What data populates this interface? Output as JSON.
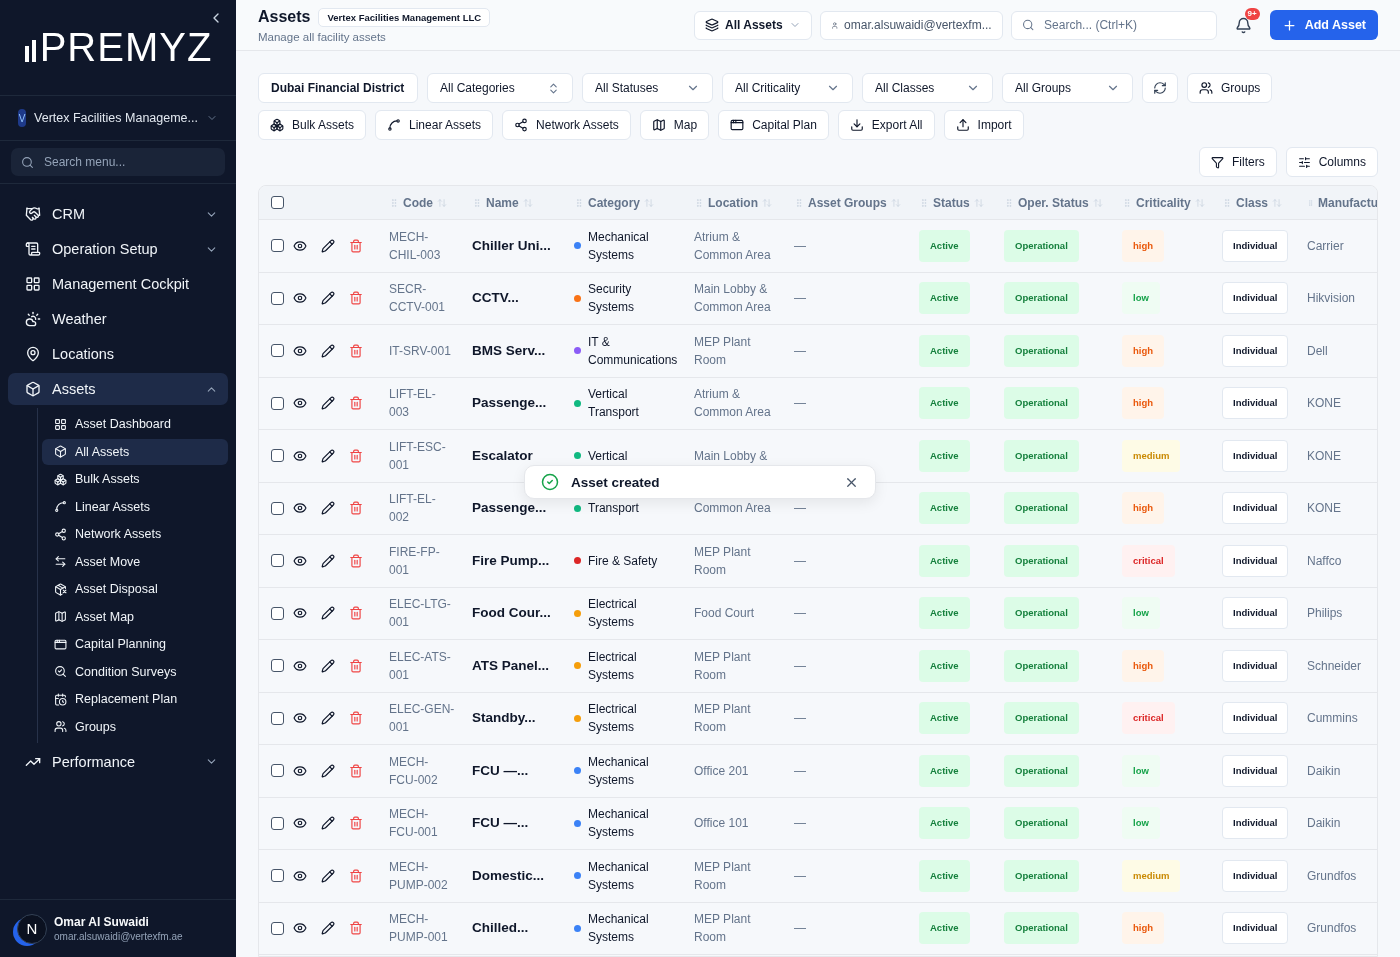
{
  "sidebar": {
    "logo": "PREMYZ",
    "org": {
      "avatar": "V",
      "name": "Vertex Facilities Manageme..."
    },
    "search": {
      "placeholder": "Search menu..."
    },
    "items": [
      {
        "label": "CRM",
        "expanded": false,
        "selected": false
      },
      {
        "label": "Operation Setup",
        "expanded": false,
        "selected": false
      },
      {
        "label": "Management Cockpit",
        "selected": false
      },
      {
        "label": "Weather",
        "selected": false
      },
      {
        "label": "Locations",
        "selected": false
      },
      {
        "label": "Assets",
        "expanded": true,
        "selected": true,
        "children": [
          {
            "label": "Asset Dashboard",
            "selected": false
          },
          {
            "label": "All Assets",
            "selected": true
          },
          {
            "label": "Bulk Assets",
            "selected": false
          },
          {
            "label": "Linear Assets",
            "selected": false
          },
          {
            "label": "Network Assets",
            "selected": false
          },
          {
            "label": "Asset Move",
            "selected": false
          },
          {
            "label": "Asset Disposal",
            "selected": false
          },
          {
            "label": "Asset Map",
            "selected": false
          },
          {
            "label": "Capital Planning",
            "selected": false
          },
          {
            "label": "Condition Surveys",
            "selected": false
          },
          {
            "label": "Replacement Plan",
            "selected": false
          },
          {
            "label": "Groups",
            "selected": false
          }
        ]
      },
      {
        "label": "Performance",
        "expanded": false,
        "selected": false
      }
    ],
    "user": {
      "avatar": "N",
      "name": "Omar Al Suwaidi",
      "email": "omar.alsuwaidi@vertexfm.ae"
    }
  },
  "header": {
    "title": "Assets",
    "org_badge": "Vertex Facilities Management LLC",
    "subtitle": "Manage all facility assets",
    "scope": "All Assets",
    "user_field": "omar.alsuwaidi@vertexfm...",
    "search": {
      "placeholder": "Search... (Ctrl+K)"
    },
    "notification_badge": "9+",
    "add_button": "Add Asset"
  },
  "filters": [
    {
      "label": "Dubai Financial District",
      "kind": "dropdown"
    },
    {
      "label": "All Categories",
      "kind": "combobox"
    },
    {
      "label": "All Statuses",
      "kind": "select"
    },
    {
      "label": "All Criticality",
      "kind": "select"
    },
    {
      "label": "All Classes",
      "kind": "select"
    },
    {
      "label": "All Groups",
      "kind": "select"
    }
  ],
  "groups_button": "Groups",
  "actions": [
    "Bulk Assets",
    "Linear Assets",
    "Network Assets",
    "Map",
    "Capital Plan",
    "Export All",
    "Import"
  ],
  "view_buttons": [
    "Filters",
    "Columns"
  ],
  "table": {
    "select_all_checked": false,
    "columns": [
      "Code",
      "Name",
      "Category",
      "Location",
      "Asset Groups",
      "Status",
      "Oper. Status",
      "Criticality",
      "Class",
      "Manufactu"
    ],
    "rows": [
      {
        "checked": false,
        "code": "MECH-CHIL-003",
        "name": "Chiller Uni...",
        "category": {
          "text": "Mechanical Systems",
          "color": "#3b82f6"
        },
        "location": "Atrium & Common Area",
        "asset_groups": "—",
        "status": "Active",
        "oper_status": "Operational",
        "criticality": {
          "text": "high",
          "kind": "high"
        },
        "class": "Individual",
        "manufacturer": "Carrier"
      },
      {
        "checked": false,
        "code": "SECR-CCTV-001",
        "name": "CCTV...",
        "category": {
          "text": "Security Systems",
          "color": "#f97316"
        },
        "location": "Main Lobby & Common Area",
        "asset_groups": "—",
        "status": "Active",
        "oper_status": "Operational",
        "criticality": {
          "text": "low",
          "kind": "low"
        },
        "class": "Individual",
        "manufacturer": "Hikvision"
      },
      {
        "checked": false,
        "code": "IT-SRV-001",
        "name": "BMS Serv...",
        "category": {
          "text": "IT & Communications",
          "color": "#8b5cf6"
        },
        "location": "MEP Plant Room",
        "asset_groups": "—",
        "status": "Active",
        "oper_status": "Operational",
        "criticality": {
          "text": "high",
          "kind": "high"
        },
        "class": "Individual",
        "manufacturer": "Dell"
      },
      {
        "checked": false,
        "code": "LIFT-EL-003",
        "name": "Passenge...",
        "category": {
          "text": "Vertical Transport",
          "color": "#10b981"
        },
        "location": "Atrium & Common Area",
        "asset_groups": "—",
        "status": "Active",
        "oper_status": "Operational",
        "criticality": {
          "text": "high",
          "kind": "high"
        },
        "class": "Individual",
        "manufacturer": "KONE"
      },
      {
        "checked": false,
        "code": "LIFT-ESC-001",
        "name": "Escalator",
        "category": {
          "text": "Vertical",
          "color": "#10b981"
        },
        "location": "Main Lobby &",
        "status": "Active",
        "oper_status": "Operational",
        "criticality": {
          "text": "medium",
          "kind": "medium"
        },
        "class": "Individual",
        "manufacturer": "KONE"
      },
      {
        "checked": false,
        "code": "LIFT-EL-002",
        "name": "Passenge...",
        "category": {
          "text": "Transport",
          "color": "#10b981"
        },
        "location": "Common Area",
        "asset_groups": "—",
        "status": "Active",
        "oper_status": "Operational",
        "criticality": {
          "text": "high",
          "kind": "high"
        },
        "class": "Individual",
        "manufacturer": "KONE"
      },
      {
        "checked": false,
        "code": "FIRE-FP-001",
        "name": "Fire Pump...",
        "category": {
          "text": "Fire & Safety",
          "color": "#dc2626"
        },
        "location": "MEP Plant Room",
        "asset_groups": "—",
        "status": "Active",
        "oper_status": "Operational",
        "criticality": {
          "text": "critical",
          "kind": "critical"
        },
        "class": "Individual",
        "manufacturer": "Naffco"
      },
      {
        "checked": false,
        "code": "ELEC-LTG-001",
        "name": "Food Cour...",
        "category": {
          "text": "Electrical Systems",
          "color": "#f59e0b"
        },
        "location": "Food Court",
        "asset_groups": "—",
        "status": "Active",
        "oper_status": "Operational",
        "criticality": {
          "text": "low",
          "kind": "low"
        },
        "class": "Individual",
        "manufacturer": "Philips"
      },
      {
        "checked": false,
        "code": "ELEC-ATS-001",
        "name": "ATS Panel...",
        "category": {
          "text": "Electrical Systems",
          "color": "#f59e0b"
        },
        "location": "MEP Plant Room",
        "asset_groups": "—",
        "status": "Active",
        "oper_status": "Operational",
        "criticality": {
          "text": "high",
          "kind": "high"
        },
        "class": "Individual",
        "manufacturer": "Schneider"
      },
      {
        "checked": false,
        "code": "ELEC-GEN-001",
        "name": "Standby...",
        "category": {
          "text": "Electrical Systems",
          "color": "#f59e0b"
        },
        "location": "MEP Plant Room",
        "asset_groups": "—",
        "status": "Active",
        "oper_status": "Operational",
        "criticality": {
          "text": "critical",
          "kind": "critical"
        },
        "class": "Individual",
        "manufacturer": "Cummins"
      },
      {
        "checked": false,
        "code": "MECH-FCU-002",
        "name": "FCU —...",
        "category": {
          "text": "Mechanical Systems",
          "color": "#3b82f6"
        },
        "location": "Office 201",
        "asset_groups": "—",
        "status": "Active",
        "oper_status": "Operational",
        "criticality": {
          "text": "low",
          "kind": "low"
        },
        "class": "Individual",
        "manufacturer": "Daikin"
      },
      {
        "checked": false,
        "code": "MECH-FCU-001",
        "name": "FCU —...",
        "category": {
          "text": "Mechanical Systems",
          "color": "#3b82f6"
        },
        "location": "Office 101",
        "asset_groups": "—",
        "status": "Active",
        "oper_status": "Operational",
        "criticality": {
          "text": "low",
          "kind": "low"
        },
        "class": "Individual",
        "manufacturer": "Daikin"
      },
      {
        "checked": false,
        "code": "MECH-PUMP-002",
        "name": "Domestic...",
        "category": {
          "text": "Mechanical Systems",
          "color": "#3b82f6"
        },
        "location": "MEP Plant Room",
        "asset_groups": "—",
        "status": "Active",
        "oper_status": "Operational",
        "criticality": {
          "text": "medium",
          "kind": "medium"
        },
        "class": "Individual",
        "manufacturer": "Grundfos"
      },
      {
        "checked": false,
        "code": "MECH-PUMP-001",
        "name": "Chilled...",
        "category": {
          "text": "Mechanical Systems",
          "color": "#3b82f6"
        },
        "location": "MEP Plant Room",
        "asset_groups": "—",
        "status": "Active",
        "oper_status": "Operational",
        "criticality": {
          "text": "high",
          "kind": "high"
        },
        "class": "Individual",
        "manufacturer": "Grundfos"
      }
    ]
  },
  "toast": {
    "message": "Asset created"
  }
}
